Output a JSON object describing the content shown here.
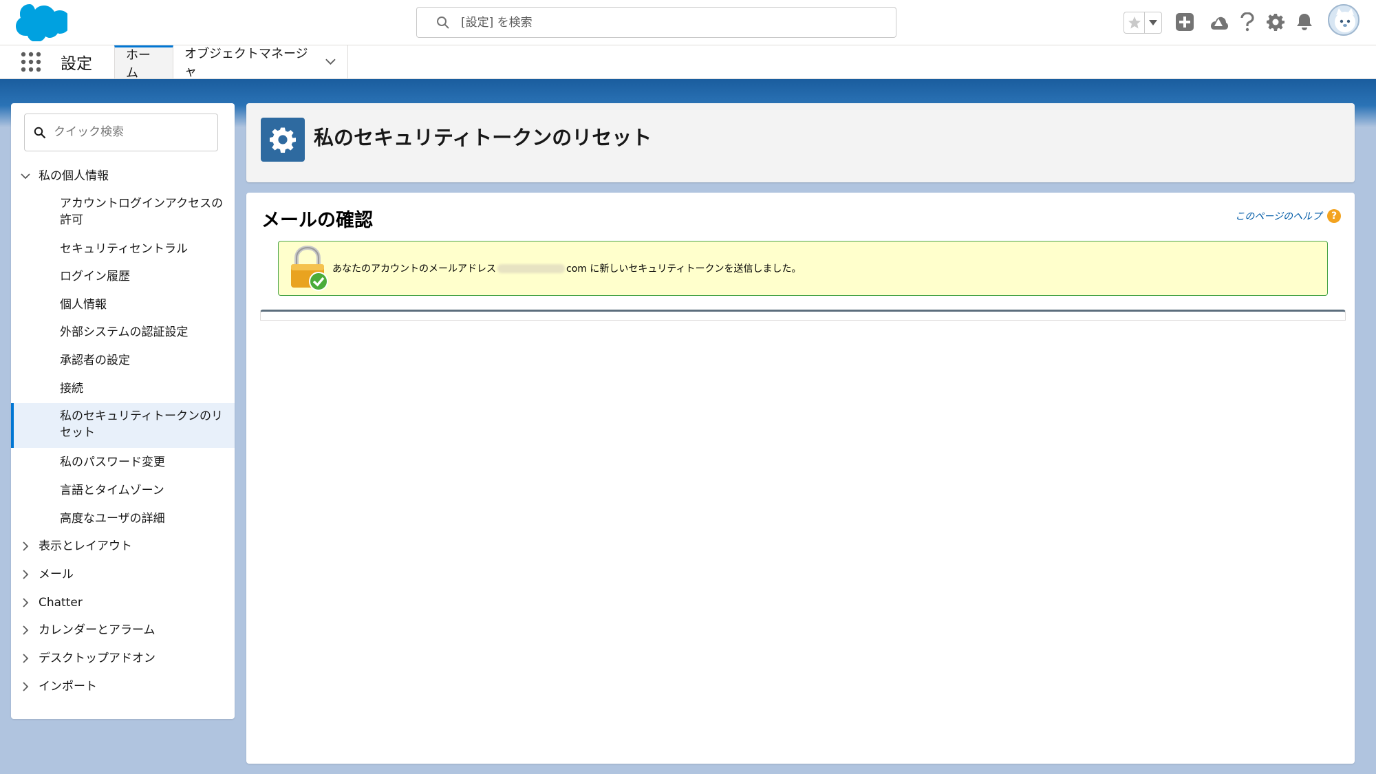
{
  "header": {
    "search_placeholder": "[設定] を検索"
  },
  "context_bar": {
    "app_name": "設定",
    "tabs": [
      {
        "label": "ホーム",
        "active": true
      },
      {
        "label": "オブジェクトマネージャ",
        "active": false
      }
    ]
  },
  "sidebar": {
    "quick_find_placeholder": "クイック検索",
    "sections": [
      {
        "label": "私の個人情報",
        "expanded": true
      },
      {
        "label": "表示とレイアウト",
        "expanded": false
      },
      {
        "label": "メール",
        "expanded": false
      },
      {
        "label": "Chatter",
        "expanded": false
      },
      {
        "label": "カレンダーとアラーム",
        "expanded": false
      },
      {
        "label": "デスクトップアドオン",
        "expanded": false
      },
      {
        "label": "インポート",
        "expanded": false
      }
    ],
    "children": [
      {
        "label": "アカウントログインアクセスの許可"
      },
      {
        "label": "セキュリティセントラル"
      },
      {
        "label": "ログイン履歴"
      },
      {
        "label": "個人情報"
      },
      {
        "label": "外部システムの認証設定"
      },
      {
        "label": "承認者の設定"
      },
      {
        "label": "接続"
      },
      {
        "label": "私のセキュリティトークンのリセット",
        "selected": true
      },
      {
        "label": "私のパスワード変更"
      },
      {
        "label": "言語とタイムゾーン"
      },
      {
        "label": "高度なユーザの詳細"
      }
    ]
  },
  "main": {
    "page_title": "私のセキュリティトークンのリセット",
    "section_title": "メールの確認",
    "help_link": "このページのヘルプ",
    "message_prefix": "あなたのアカウントのメールアドレス",
    "message_suffix": "com に新しいセキュリティトークンを送信しました。"
  },
  "colors": {
    "brand": "#0176d3",
    "header_badge": "#2e6aa0",
    "message_bg": "#ffffcc",
    "message_border": "#48a348",
    "help_icon": "#f3a31f"
  },
  "icons": {
    "logo": "salesforce-cloud-logo",
    "search": "search-icon",
    "favorite": "star-icon",
    "add": "plus-icon",
    "trailhead": "trailhead-icon",
    "help": "question-icon",
    "setup": "gear-icon",
    "notifications": "bell-icon",
    "page_badge": "gear-icon",
    "message": "lock-check-icon"
  }
}
